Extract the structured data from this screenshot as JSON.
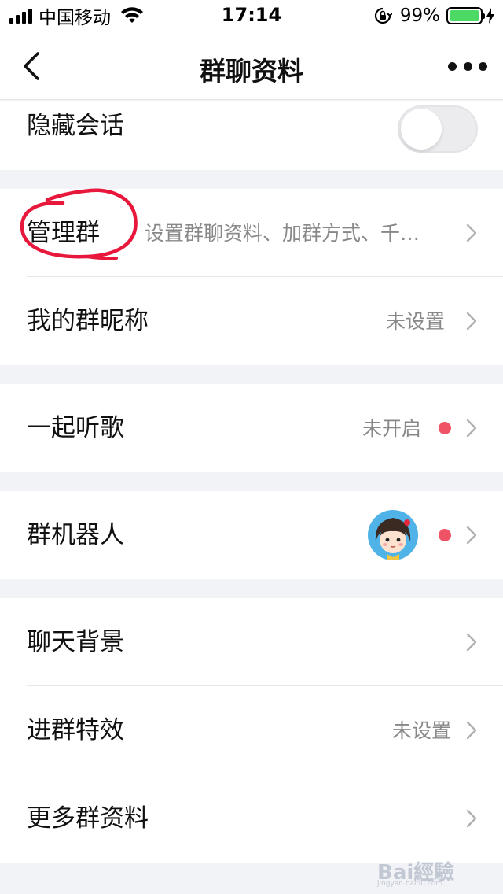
{
  "status_bar": {
    "carrier": "中国移动",
    "time": "17:14",
    "battery_percent": "99%",
    "battery_level": 0.99,
    "icons": [
      "signal-icon",
      "wifi-icon",
      "rotation-lock-icon",
      "battery-icon",
      "charging-icon"
    ]
  },
  "nav": {
    "title": "群聊资料",
    "back_icon": "chevron-left-icon",
    "more_icon": "more-dots-icon"
  },
  "hide_chat": {
    "label": "隐藏会话",
    "toggle_on": false
  },
  "manage_group": {
    "label": "管理群",
    "value": "设置群聊资料、加群方式、千…",
    "annotation": "red-hand-drawn-circle"
  },
  "my_nickname": {
    "label": "我的群昵称",
    "value": "未设置"
  },
  "listen_together": {
    "label": "一起听歌",
    "value": "未开启",
    "dot_color": "#ef5366"
  },
  "group_robot": {
    "label": "群机器人",
    "avatar": "robot-girl-avatar-icon",
    "dot_color": "#ef5366"
  },
  "chat_background": {
    "label": "聊天背景"
  },
  "entry_effect": {
    "label": "进群特效",
    "value": "未设置"
  },
  "more_info": {
    "label": "更多群资料"
  },
  "watermark": {
    "brand": "Bai經驗",
    "url": "jingyan.baidu.com"
  },
  "colors": {
    "background": "#f2f3f6",
    "accent_dot": "#ef5366",
    "battery": "#4cd964",
    "annotation": "#e8183c"
  }
}
